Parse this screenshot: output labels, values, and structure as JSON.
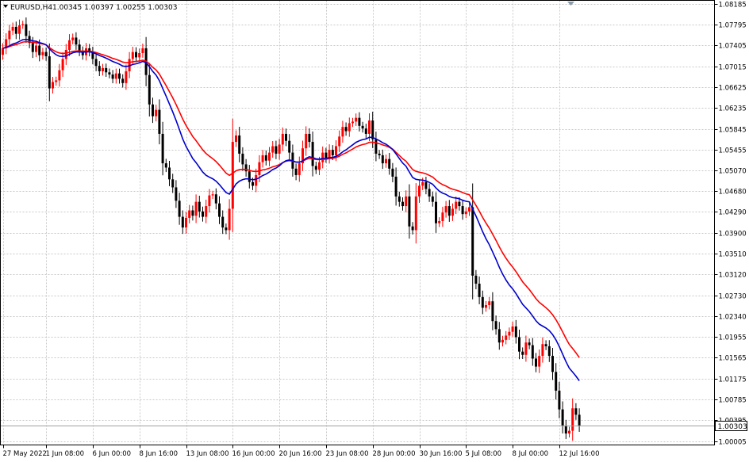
{
  "header": {
    "symbol_timeframe": "EURUSD,H4",
    "ohlc": "1.00345 1.00397 1.00255 1.00303"
  },
  "current_price_label": "1.00303",
  "icons": {
    "scroll_marker": "shift-triangle-icon"
  },
  "colors": {
    "bull": "#ff0000",
    "bear": "#000000",
    "ma_fast": "#0000cc",
    "ma_slow": "#ff0000",
    "grid": "#c8c8c8",
    "frame": "#000000",
    "price_line": "#a0a0a0",
    "price_label_bg": "#ffffff"
  },
  "chart_data": {
    "type": "candlestick",
    "grid": true,
    "ylim": [
      0.99935,
      1.08245
    ],
    "y_ticks": [
      "1.08185",
      "1.07795",
      "1.07405",
      "1.07015",
      "1.06625",
      "1.06235",
      "1.05845",
      "1.05455",
      "1.05070",
      "1.04680",
      "1.04290",
      "1.03900",
      "1.03510",
      "1.03120",
      "1.02730",
      "1.02340",
      "1.01955",
      "1.01565",
      "1.01175",
      "1.00785",
      "1.00395",
      "1.00005"
    ],
    "x_labels": [
      {
        "label": "27 May 2022",
        "bar": 0
      },
      {
        "label": "1 Jun 08:00",
        "bar": 13
      },
      {
        "label": "6 Jun 00:00",
        "bar": 27
      },
      {
        "label": "8 Jun 16:00",
        "bar": 41
      },
      {
        "label": "13 Jun 08:00",
        "bar": 55
      },
      {
        "label": "16 Jun 00:00",
        "bar": 69
      },
      {
        "label": "20 Jun 16:00",
        "bar": 83
      },
      {
        "label": "23 Jun 08:00",
        "bar": 97
      },
      {
        "label": "28 Jun 00:00",
        "bar": 111
      },
      {
        "label": "30 Jun 16:00",
        "bar": 125
      },
      {
        "label": "5 Jul 08:00",
        "bar": 139
      },
      {
        "label": "8 Jul 00:00",
        "bar": 153
      },
      {
        "label": "12 Jul 16:00",
        "bar": 167
      }
    ],
    "close": [
      1.0735,
      1.0752,
      1.0768,
      1.0775,
      1.0762,
      1.0778,
      1.078,
      1.0758,
      1.0745,
      1.0728,
      1.074,
      1.0722,
      1.0728,
      1.072,
      1.066,
      1.0672,
      1.0675,
      1.0694,
      1.0715,
      1.0732,
      1.075,
      1.0755,
      1.0742,
      1.073,
      1.0722,
      1.0735,
      1.0728,
      1.0715,
      1.0702,
      1.0692,
      1.0698,
      1.069,
      1.0686,
      1.0678,
      1.0688,
      1.0678,
      1.067,
      1.0692,
      1.0715,
      1.0728,
      1.0718,
      1.0726,
      1.0735,
      1.0685,
      1.063,
      1.0608,
      1.062,
      1.0575,
      1.052,
      1.0512,
      1.049,
      1.0475,
      1.045,
      1.042,
      1.04,
      1.0418,
      1.0432,
      1.0422,
      1.0448,
      1.043,
      1.042,
      1.044,
      1.046,
      1.0462,
      1.0445,
      1.042,
      1.04,
      1.0395,
      1.0435,
      1.056,
      1.0572,
      1.0538,
      1.0518,
      1.0505,
      1.0485,
      1.0478,
      1.0498,
      1.0522,
      1.0535,
      1.0525,
      1.054,
      1.0552,
      1.0538,
      1.0555,
      1.0575,
      1.0562,
      1.054,
      1.051,
      1.0498,
      1.052,
      1.0548,
      1.0575,
      1.056,
      1.0515,
      1.0508,
      1.0522,
      1.054,
      1.053,
      1.0545,
      1.0535,
      1.0552,
      1.057,
      1.0588,
      1.058,
      1.0595,
      1.0598,
      1.0605,
      1.059,
      1.0585,
      1.0575,
      1.06,
      1.0565,
      1.0538,
      1.0535,
      1.052,
      1.0528,
      1.051,
      1.0495,
      1.0458,
      1.0448,
      1.044,
      1.0458,
      1.0402,
      1.0395,
      1.0458,
      1.0478,
      1.0485,
      1.0472,
      1.0458,
      1.0448,
      1.0408,
      1.0412,
      1.0428,
      1.044,
      1.0422,
      1.0435,
      1.0448,
      1.044,
      1.0425,
      1.043,
      1.0438,
      1.031,
      1.0295,
      1.027,
      1.025,
      1.0255,
      1.0262,
      1.0225,
      1.021,
      1.0185,
      1.019,
      1.0198,
      1.0205,
      1.0215,
      1.0195,
      1.0168,
      1.0162,
      1.0185,
      1.018,
      1.0155,
      1.014,
      1.016,
      1.0182,
      1.0178,
      1.016,
      1.013,
      1.0095,
      1.006,
      1.003,
      1.0015,
      1.002,
      1.0062,
      1.005,
      1.003
    ]
  }
}
